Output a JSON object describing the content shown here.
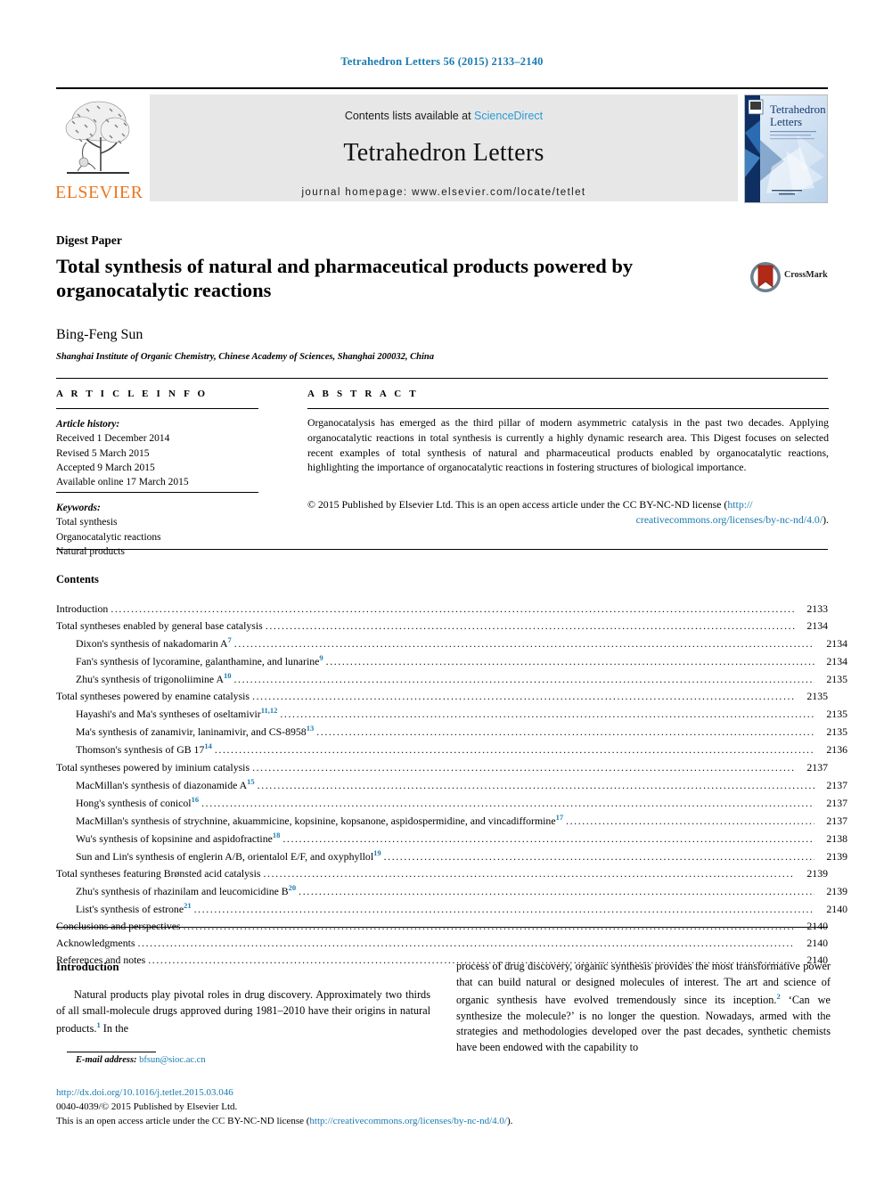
{
  "journal_line": "Tetrahedron Letters 56 (2015) 2133–2140",
  "masthead": {
    "contents_prefix": "Contents lists available at ",
    "sciencedirect": "ScienceDirect",
    "journal_title": "Tetrahedron Letters",
    "homepage": "journal homepage: www.elsevier.com/locate/tetlet",
    "publisher_wordmark": "ELSEVIER",
    "cover_title_line1": "Tetrahedron",
    "cover_title_line2": "Letters"
  },
  "article": {
    "type_label": "Digest Paper",
    "title": "Total synthesis of natural and pharmaceutical products powered by organocatalytic reactions",
    "author": "Bing-Feng Sun",
    "affiliation": "Shanghai Institute of Organic Chemistry, Chinese Academy of Sciences, Shanghai 200032, China",
    "crossmark_label": "CrossMark"
  },
  "info": {
    "heading": "A R T I C L E    I N F O",
    "history_label": "Article history:",
    "history": [
      "Received 1 December 2014",
      "Revised 5 March 2015",
      "Accepted 9 March 2015",
      "Available online 17 March 2015"
    ],
    "keywords_label": "Keywords:",
    "keywords": [
      "Total synthesis",
      "Organocatalytic reactions",
      "Natural products"
    ]
  },
  "abstract": {
    "heading": "A B S T R A C T",
    "text": "Organocatalysis has emerged as the third pillar of modern asymmetric catalysis in the past two decades. Applying organocatalytic reactions in total synthesis is currently a highly dynamic research area. This Digest focuses on selected recent examples of total synthesis of natural and pharmaceutical products enabled by organocatalytic reactions, highlighting the importance of organocatalytic reactions in fostering structures of biological importance.",
    "copyright": "© 2015 Published by Elsevier Ltd. This is an open access article under the CC BY-NC-ND license (",
    "license_url_part1": "http://",
    "license_url_part2": "creativecommons.org/licenses/by-nc-nd/4.0/",
    "copyright_tail": ")."
  },
  "contents": {
    "heading": "Contents",
    "entries": [
      {
        "level": 0,
        "text": "Introduction",
        "ref": "",
        "page": "2133"
      },
      {
        "level": 0,
        "text": "Total syntheses enabled by general base catalysis",
        "ref": "",
        "page": "2134"
      },
      {
        "level": 1,
        "text": "Dixon's synthesis of nakadomarin A",
        "ref": "7",
        "page": "2134"
      },
      {
        "level": 1,
        "text": "Fan's synthesis of lycoramine, galanthamine, and lunarine",
        "ref": "9",
        "page": "2134"
      },
      {
        "level": 1,
        "text": "Zhu's synthesis of trigonoliimine A",
        "ref": "10",
        "page": "2135"
      },
      {
        "level": 0,
        "text": "Total syntheses powered by enamine catalysis",
        "ref": "",
        "page": "2135"
      },
      {
        "level": 1,
        "text": "Hayashi's and Ma's syntheses of oseltamivir",
        "ref": "11,12",
        "page": "2135"
      },
      {
        "level": 1,
        "text": "Ma's synthesis of zanamivir, laninamivir, and CS-8958",
        "ref": "13",
        "page": "2135"
      },
      {
        "level": 1,
        "text": "Thomson's synthesis of GB 17",
        "ref": "14",
        "page": "2136"
      },
      {
        "level": 0,
        "text": "Total syntheses powered by iminium catalysis",
        "ref": "",
        "page": "2137"
      },
      {
        "level": 1,
        "text": "MacMillan's synthesis of diazonamide A",
        "ref": "15",
        "page": "2137"
      },
      {
        "level": 1,
        "text": "Hong's synthesis of conicol",
        "ref": "16",
        "page": "2137"
      },
      {
        "level": 1,
        "text": "MacMillan's synthesis of strychnine, akuammicine, kopsinine, kopsanone, aspidospermidine, and vincadifformine",
        "ref": "17",
        "page": "2137"
      },
      {
        "level": 1,
        "text": "Wu's synthesis of kopsinine and aspidofractine",
        "ref": "18",
        "page": "2138"
      },
      {
        "level": 1,
        "text": "Sun and Lin's synthesis of englerin A/B, orientalol E/F, and oxyphyllol",
        "ref": "19",
        "page": "2139"
      },
      {
        "level": 0,
        "text": "Total syntheses featuring Brønsted acid catalysis",
        "ref": "",
        "page": "2139"
      },
      {
        "level": 1,
        "text": "Zhu's synthesis of rhazinilam and leucomicidine B",
        "ref": "20",
        "page": "2139"
      },
      {
        "level": 1,
        "text": "List's synthesis of estrone",
        "ref": "21",
        "page": "2140"
      },
      {
        "level": 0,
        "text": "Conclusions and perspectives",
        "ref": "",
        "page": "2140"
      },
      {
        "level": 0,
        "text": "Acknowledgments",
        "ref": "",
        "page": "2140"
      },
      {
        "level": 0,
        "text": "References and notes",
        "ref": "",
        "page": "2140"
      }
    ]
  },
  "body": {
    "intro_heading": "Introduction",
    "left_paragraph_a": "Natural products play pivotal roles in drug discovery. Approximately two thirds of all small-molecule drugs approved during 1981–2010 have their origins in natural products.",
    "left_ref_1": "1",
    "left_paragraph_b": " In the",
    "right_text_a": "process of drug discovery, organic synthesis provides the most transformative power that can build natural or designed molecules of interest. The art and science of organic synthesis have evolved tremendously since its inception.",
    "right_ref_2": "2",
    "right_text_b": " ‘Can we synthesize the molecule?’ is no longer the question. Nowadays, armed with the strategies and methodologies developed over the past decades, synthetic chemists have been endowed with the capability to"
  },
  "footnote": {
    "label": "E-mail address:",
    "email": "bfsun@sioc.ac.cn"
  },
  "footer": {
    "doi": "http://dx.doi.org/10.1016/j.tetlet.2015.03.046",
    "issn_line": "0040-4039/© 2015 Published by Elsevier Ltd.",
    "license_prefix": "This is an open access article under the CC BY-NC-ND license (",
    "license_url": "http://creativecommons.org/licenses/by-nc-nd/4.0/",
    "license_suffix": ")."
  },
  "colors": {
    "link": "#1a7bb0",
    "sciencedirect": "#2b9ad6",
    "elsevier_orange": "#E87722",
    "masthead_bg": "#e7e7e7"
  }
}
